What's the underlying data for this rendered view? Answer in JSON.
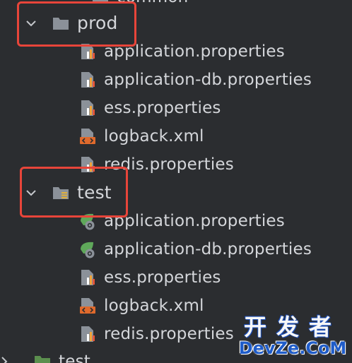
{
  "tree": {
    "top_partial_label": "common",
    "prod": {
      "label": "prod",
      "files": [
        {
          "label": "application.properties",
          "icon": "properties-file-icon"
        },
        {
          "label": "application-db.properties",
          "icon": "properties-file-icon"
        },
        {
          "label": "ess.properties",
          "icon": "properties-file-icon"
        },
        {
          "label": "logback.xml",
          "icon": "xml-file-icon"
        },
        {
          "label": "redis.properties",
          "icon": "properties-file-icon"
        }
      ]
    },
    "test": {
      "label": "test",
      "files": [
        {
          "label": "application.properties",
          "icon": "spring-properties-file-icon"
        },
        {
          "label": "application-db.properties",
          "icon": "spring-properties-file-icon"
        },
        {
          "label": "ess.properties",
          "icon": "properties-file-icon"
        },
        {
          "label": "logback.xml",
          "icon": "xml-file-icon"
        },
        {
          "label": "redis.properties",
          "icon": "properties-file-icon"
        }
      ]
    },
    "bottom_partial_label": "test"
  },
  "watermark": {
    "top": "开发者",
    "bottom": "DevZe.CoM"
  },
  "colors": {
    "background": "#2b2d30",
    "text": "#d4d6da",
    "highlight": "#e8453a",
    "folder": "#8b9199"
  }
}
